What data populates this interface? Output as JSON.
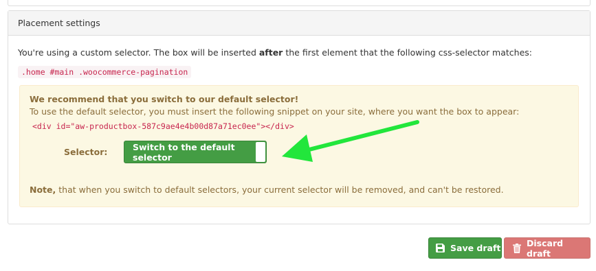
{
  "panel": {
    "heading": "Placement settings",
    "intro_before": "You're using a custom selector. The box will be inserted ",
    "intro_bold": "after",
    "intro_after": " the first element that the following css-selector matches:",
    "custom_selector": ".home #main .woocommerce-pagination"
  },
  "warning": {
    "title": "We recommend that you switch to our default selector!",
    "text": "To use the default selector, you must insert the following snippet on your site, where you want the box to appear:",
    "snippet": "<div id=\"aw-productbox-587c9ae4e4b00d87a71ec0ee\"></div>",
    "selector_label": "Selector:",
    "switch_button": "Switch to the default selector",
    "note_bold": "Note,",
    "note_text": " that when you switch to default selectors, your current selector will be removed, and can't be restored."
  },
  "footer": {
    "save_label": "Save draft",
    "save_icon": "floppy-disk-icon",
    "discard_label": "Discard draft",
    "discard_icon": "trash-icon"
  },
  "colors": {
    "success": "#449d44",
    "danger": "#c9302c",
    "warning_bg": "#fcf8e3",
    "warning_text": "#8a6d3b",
    "code": "#c7254e",
    "annotation_arrow": "#22e63c"
  }
}
